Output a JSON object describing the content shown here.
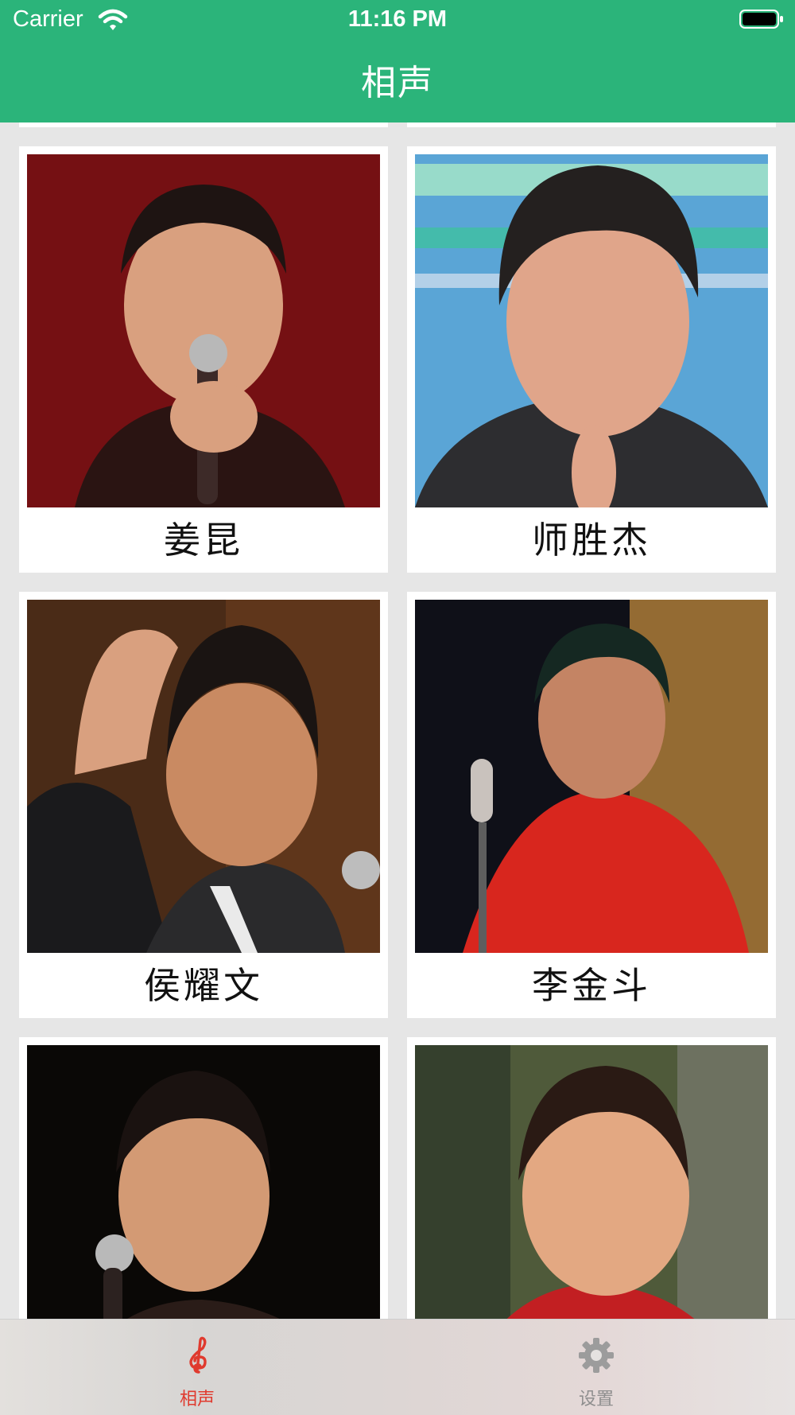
{
  "status_bar": {
    "carrier": "Carrier",
    "time": "11:16 PM"
  },
  "nav": {
    "title": "相声"
  },
  "performers": [
    {
      "name": "姜昆"
    },
    {
      "name": "师胜杰"
    },
    {
      "name": "侯耀文"
    },
    {
      "name": "李金斗"
    },
    {
      "name": ""
    },
    {
      "name": ""
    }
  ],
  "tabbar": {
    "tabs": [
      {
        "label": "相声",
        "icon": "treble-clef-icon",
        "active": true
      },
      {
        "label": "设置",
        "icon": "gear-icon",
        "active": false
      }
    ]
  },
  "colors": {
    "header": "#2bb47a",
    "active_tab": "#e03a2e",
    "inactive_tab": "#8e8e8e"
  }
}
